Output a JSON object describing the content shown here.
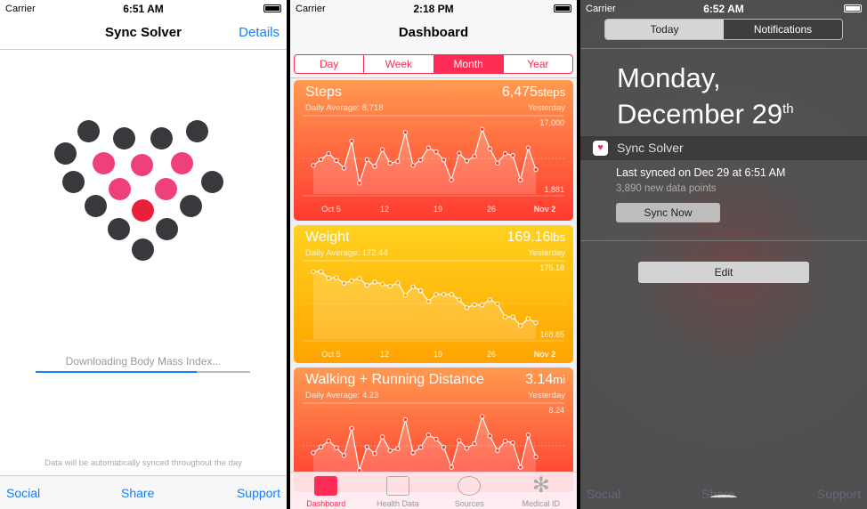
{
  "left": {
    "status": {
      "carrier": "Carrier",
      "time": "6:51 AM"
    },
    "nav": {
      "title": "Sync Solver",
      "details": "Details"
    },
    "progress": {
      "label": "Downloading Body Mass Index...",
      "value_percent": 75
    },
    "footer_note": "Data will be automatically synced throughout the day",
    "toolbar": {
      "social": "Social",
      "share": "Share",
      "support": "Support"
    },
    "colors": {
      "accent": "#157efb",
      "dot_dark": "#38393d",
      "dot_pink": "#f0407a",
      "dot_red": "#e8203a"
    }
  },
  "middle": {
    "status": {
      "carrier": "Carrier",
      "time": "2:18 PM"
    },
    "nav": {
      "title": "Dashboard"
    },
    "segments": [
      "Day",
      "Week",
      "Month",
      "Year"
    ],
    "selected_segment": "Month",
    "tabs": [
      {
        "label": "Dashboard",
        "icon": "chart-icon",
        "active": true
      },
      {
        "label": "Health Data",
        "icon": "folder-heart-icon"
      },
      {
        "label": "Sources",
        "icon": "heart-download-icon"
      },
      {
        "label": "Medical ID",
        "icon": "asterisk-icon"
      }
    ]
  },
  "right": {
    "status": {
      "carrier": "Carrier",
      "time": "6:52 AM"
    },
    "tabs": [
      "Today",
      "Notifications"
    ],
    "selected_tab": "Today",
    "date_line1": "Monday,",
    "date_line2": "December 29",
    "date_suffix": "th",
    "widget": {
      "app": "Sync Solver",
      "last_synced": "Last synced on Dec 29 at 6:51 AM",
      "points": "3,890 new data points",
      "button": "Sync Now"
    },
    "edit": "Edit",
    "behind": {
      "social": "Social",
      "share": "Share",
      "support": "Support"
    }
  },
  "chart_data": [
    {
      "type": "line",
      "title": "Steps",
      "avg": "Daily Average: 8,718",
      "value": "6,475",
      "unit": "steps",
      "when": "Yesterday",
      "ymax_label": "17,000",
      "ymin_label": "1,881",
      "ylim": [
        1881,
        17000
      ],
      "xticks": [
        "Oct 5",
        "12",
        "19",
        "26",
        "Nov 2"
      ],
      "values": [
        7400,
        8700,
        10000,
        8500,
        6800,
        12800,
        3500,
        8700,
        7200,
        10900,
        7900,
        8300,
        14700,
        7400,
        8600,
        11300,
        10400,
        8600,
        4200,
        10100,
        8400,
        9400,
        15400,
        11100,
        7900,
        10000,
        9600,
        4200,
        11300,
        6475
      ],
      "color_top": "#ff9a50",
      "color_bottom": "#ff3a30"
    },
    {
      "type": "line",
      "title": "Weight",
      "avg": "Daily Average: 172.44",
      "value": "169.16",
      "unit": "lbs",
      "when": "Yesterday",
      "ymax_label": "175.18",
      "ymin_label": "168.85",
      "ylim": [
        168.85,
        175.18
      ],
      "xticks": [
        "Oct 5",
        "12",
        "19",
        "26",
        "Nov 2"
      ],
      "values": [
        174.5,
        174.5,
        173.9,
        173.95,
        173.43,
        173.65,
        173.87,
        173.24,
        173.54,
        173.35,
        173.16,
        173.46,
        172.32,
        173.11,
        172.75,
        171.74,
        172.4,
        172.4,
        172.4,
        171.91,
        171.17,
        171.44,
        171.42,
        171.91,
        171.53,
        170.32,
        170.32,
        169.51,
        170.16,
        169.78
      ],
      "color_top": "#ffd21e",
      "color_bottom": "#ffa400"
    },
    {
      "type": "line",
      "title": "Walking + Running Distance",
      "avg": "Daily Average: 4.23",
      "value": "3.14",
      "unit": "mi",
      "when": "Yesterday",
      "ymax_label": "8.24",
      "ylim": [
        0.9,
        8.24
      ],
      "xticks": [],
      "values": [
        3.59,
        4.22,
        4.85,
        4.13,
        3.3,
        6.21,
        1.7,
        4.22,
        3.5,
        5.29,
        3.83,
        4.03,
        7.14,
        3.59,
        4.17,
        5.49,
        5.05,
        4.17,
        2.04,
        4.9,
        4.08,
        4.56,
        7.48,
        5.39,
        3.83,
        4.85,
        4.66,
        2.04,
        5.49,
        3.14
      ],
      "color_top": "#ff9a50",
      "color_bottom": "#ff3a30"
    }
  ]
}
